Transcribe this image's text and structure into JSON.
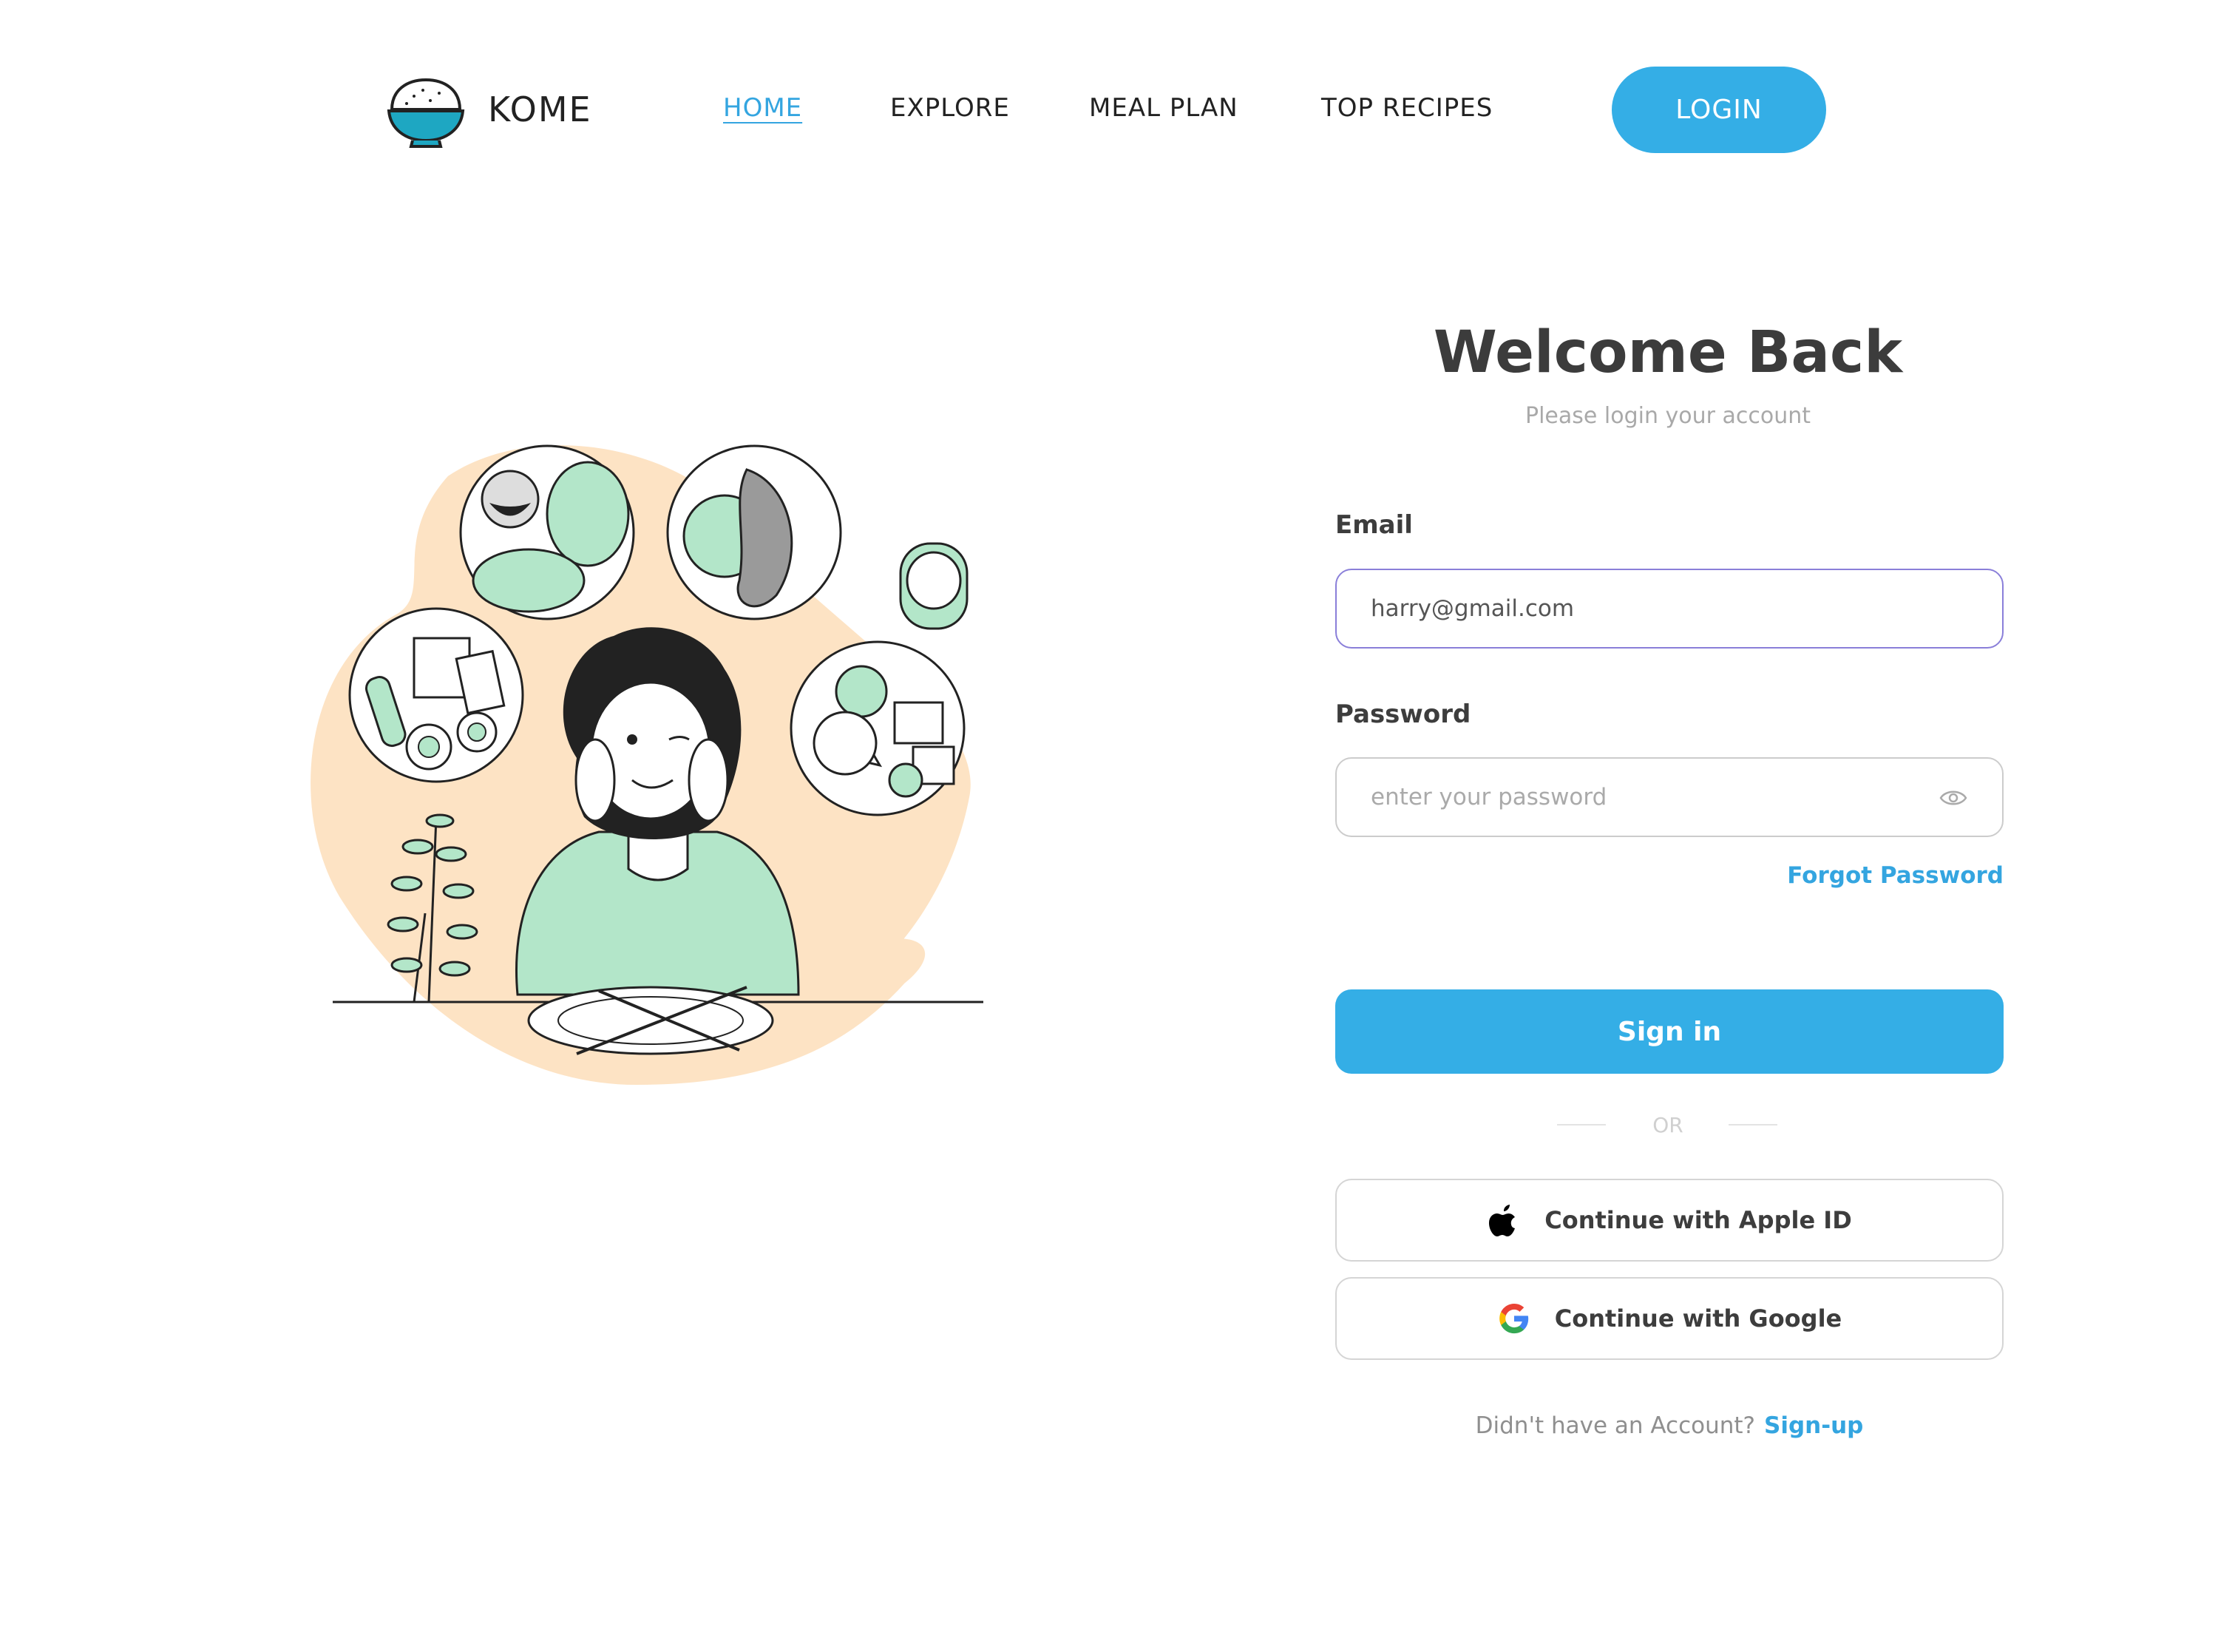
{
  "header": {
    "brand": "KOME",
    "nav": [
      "HOME",
      "EXPLORE",
      "MEAL PLAN",
      "TOP RECIPES"
    ],
    "active_nav": "HOME",
    "login_label": "LOGIN"
  },
  "form": {
    "title": "Welcome Back",
    "subtitle": "Please login your account",
    "email_label": "Email",
    "email_value": "harry@gmail.com",
    "password_label": "Password",
    "password_placeholder": "enter your password",
    "forgot_label": "Forgot Password",
    "signin_label": "Sign in",
    "or_label": "OR",
    "apple_label": "Continue with Apple ID",
    "google_label": "Continue with Google",
    "no_account_text": "Didn't have an Account?",
    "signup_label": "Sign-up"
  },
  "colors": {
    "accent": "#34aee6",
    "link": "#34a5e0",
    "illustration_bg": "#fde3c4",
    "illustration_green": "#b3e6c9",
    "focus_border": "#8a7fd9"
  },
  "icons": [
    "rice-bowl-logo-icon",
    "eye-icon",
    "apple-icon",
    "google-icon"
  ]
}
